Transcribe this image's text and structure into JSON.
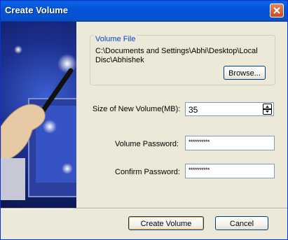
{
  "window": {
    "title": "Create Volume"
  },
  "volume_file": {
    "group_label": "Volume File",
    "path": "C:\\Documents and Settings\\Abhi\\Desktop\\Local Disc\\Abhishek",
    "browse_label": "Browse..."
  },
  "size": {
    "label": "Size of New Volume(MB):",
    "value": "35"
  },
  "password": {
    "label": "Volume Password:",
    "value": "**********"
  },
  "confirm": {
    "label": "Confirm Password:",
    "value": "**********"
  },
  "buttons": {
    "create": "Create Volume",
    "cancel": "Cancel"
  },
  "icons": {
    "close": "close-icon",
    "spin_up": "arrow-up-icon",
    "spin_down": "arrow-down-icon"
  },
  "colors": {
    "titlebar": "#0353d9",
    "close_button": "#c84a22",
    "group_label": "#0046d5",
    "dialog_bg": "#ece9d8"
  }
}
